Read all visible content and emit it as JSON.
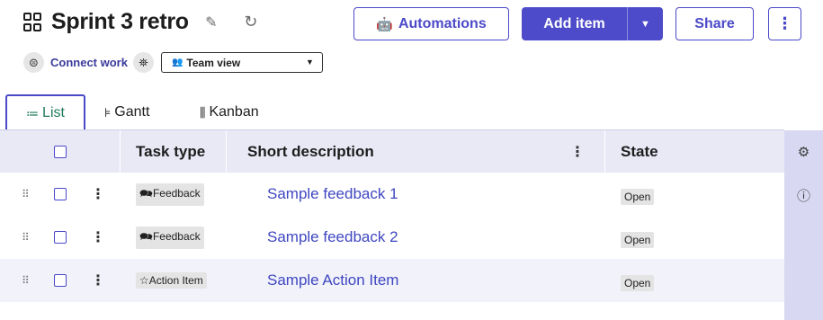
{
  "header": {
    "title": "Sprint 3 retro",
    "automations_label": "Automations",
    "add_item_label": "Add item",
    "share_label": "Share"
  },
  "subheader": {
    "connect_label": "Connect work",
    "view_selected": "Team view"
  },
  "tabs": [
    {
      "label": "List",
      "active": true
    },
    {
      "label": "Gantt",
      "active": false
    },
    {
      "label": "Kanban",
      "active": false
    }
  ],
  "table": {
    "columns": [
      "Task type",
      "Short description",
      "State"
    ],
    "rows": [
      {
        "task_type": "Feedback",
        "task_icon": "chat-bubbles-icon",
        "description": "Sample feedback 1",
        "state": "Open"
      },
      {
        "task_type": "Feedback",
        "task_icon": "chat-bubbles-icon",
        "description": "Sample feedback 2",
        "state": "Open"
      },
      {
        "task_type": "Action Item",
        "task_icon": "star-icon",
        "description": "Sample Action Item",
        "state": "Open"
      }
    ]
  },
  "colors": {
    "accent": "#4d4bc9",
    "link": "#3f47c0",
    "header_row": "#e8e9f5",
    "side_rail": "#d8d8f2",
    "active_tab_text": "#1f7a5c"
  }
}
